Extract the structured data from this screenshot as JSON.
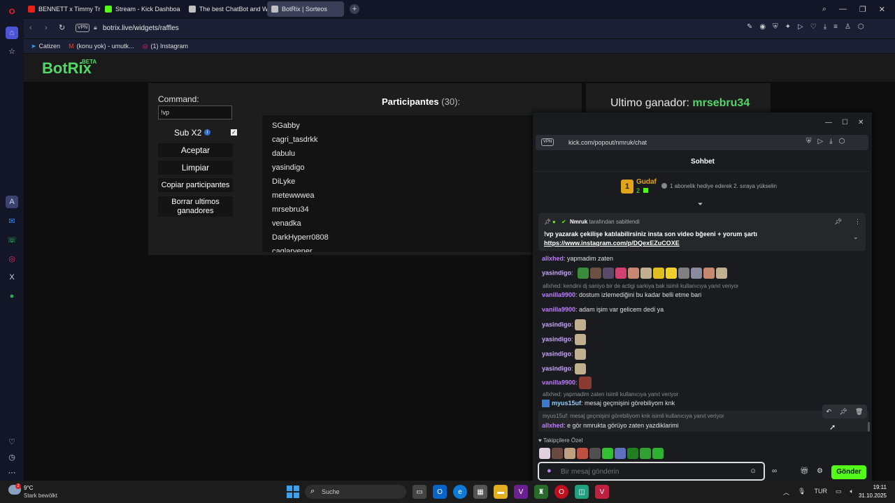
{
  "tabs": [
    {
      "label": "BENNETT x Timmy Trump",
      "color": "#e62117"
    },
    {
      "label": "Stream - Kick Dashboard",
      "color": "#53fc18"
    },
    {
      "label": "The best ChatBot and Wi",
      "color": "#c0c0c0"
    },
    {
      "label": "BotRix | Sorteos",
      "color": "#c0c0c0"
    }
  ],
  "address": {
    "vpn": "VPN",
    "url": "botrix.live/widgets/raffles"
  },
  "bookmarks": [
    "Catizen",
    "(konu yok) - umutk...",
    "(1) Instagram"
  ],
  "botrix": {
    "logo": "BotRix",
    "beta": "BETA"
  },
  "raffle": {
    "command_label": "Command:",
    "command_value": "!vp",
    "sub_label": "Sub X2",
    "buttons": [
      "Aceptar",
      "Limpiar",
      "Copiar participantes",
      "Borrar ultimos ganadores"
    ],
    "participants_label": "Participantes",
    "participants_count": "(30):",
    "participants": [
      "SGabby",
      "cagri_tasdrkk",
      "dabulu",
      "yasindigo",
      "DiLyke",
      "metewwwea",
      "mrsebru34",
      "venadka",
      "DarkHyperr0808",
      "caglaryener"
    ],
    "winner_label": "Ultimo ganador:",
    "winner_name": "mrsebru34"
  },
  "popup": {
    "vpn": "VPN",
    "url": "kick.com/popout/nmruk/chat",
    "title": "Sohbet",
    "gift_user": "Gudaf",
    "gift_rank": "1",
    "gift_count": "2",
    "gift_text": "1 abonelik hediye ederek 2. sıraya yükselin",
    "pinned_by_user": "Nmruk",
    "pinned_by_text": "tarafından sabitlendi",
    "pinned_text": "!vp yazarak çekilişe katılabilirsiniz insta son video bğeeni + yorum şartı",
    "pinned_link": "https://www.instagram.com/p/DQexEZuCOXE",
    "messages": [
      {
        "user": "allxhed",
        "text": ": yapmadim zaten"
      },
      {
        "user": "yasindigo",
        "text": ":"
      },
      {
        "reply": "allxhed: kendini dj saniyo bir de actigi sarkiya bak isimli kullanıcıya yanıt veriyor"
      },
      {
        "user": "vanilla9900",
        "text": ": dostum izlemediğini bu kadar belli etme bari"
      },
      {
        "user": "vanilla9900",
        "text": ": adam işim var gelicem dedi ya"
      },
      {
        "user": "yasindigo",
        "text": ":"
      },
      {
        "user": "yasindigo",
        "text": ":"
      },
      {
        "user": "yasindigo",
        "text": ":"
      },
      {
        "user": "yasindigo",
        "text": ":"
      },
      {
        "user": "vanilla9900",
        "text": ":"
      },
      {
        "reply": "allxhed: yapmadim zaten isimli kullanıcıya yanıt veriyor"
      },
      {
        "user": "myus15uf",
        "text": ": mesaj geçmişini görebiliyom knk"
      },
      {
        "reply": "myus15uf: mesaj geçmişini görebiliyom knk isimli kullanıcıya yanıt veriyor"
      },
      {
        "user": "allxhed",
        "text": ": e gör nmrukta görüyo zaten yazdiklarimi"
      }
    ],
    "followers_label": "Takipçilere Özel",
    "input_placeholder": "Bir mesaj gönderin",
    "send_label": "Gönder"
  },
  "taskbar": {
    "weather_temp": "9°C",
    "weather_text": "Stark bewölkt",
    "weather_badge": "2",
    "search_placeholder": "Suche",
    "lang": "TUR",
    "time": "19:11",
    "date": "31.10.2025"
  }
}
